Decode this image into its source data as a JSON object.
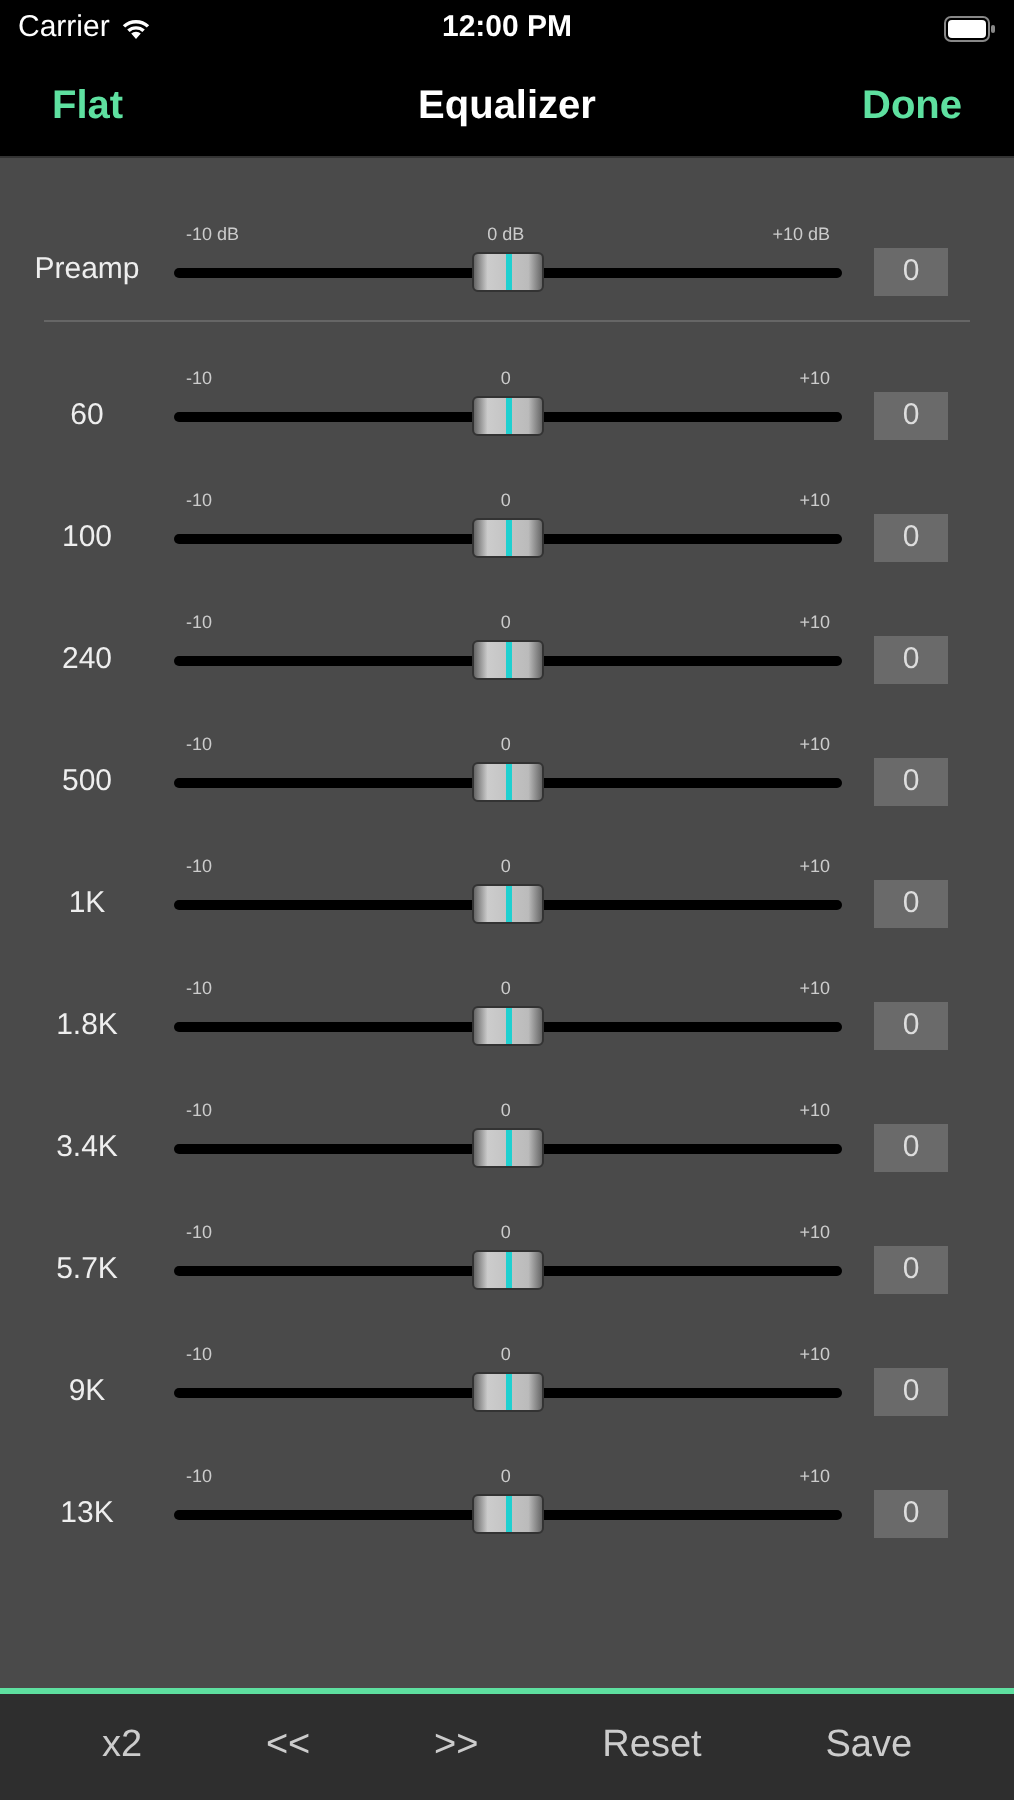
{
  "status_bar": {
    "carrier": "Carrier",
    "time": "12:00 PM"
  },
  "nav": {
    "left": "Flat",
    "title": "Equalizer",
    "right": "Done"
  },
  "preamp": {
    "label": "Preamp",
    "scale": [
      "-10 dB",
      "0 dB",
      "+10 dB"
    ],
    "level": 0.5,
    "value": "0"
  },
  "bands": [
    {
      "label": "60",
      "scale": [
        "-10",
        "0",
        "+10"
      ],
      "level": 0.5,
      "value": "0"
    },
    {
      "label": "100",
      "scale": [
        "-10",
        "0",
        "+10"
      ],
      "level": 0.5,
      "value": "0"
    },
    {
      "label": "240",
      "scale": [
        "-10",
        "0",
        "+10"
      ],
      "level": 0.5,
      "value": "0"
    },
    {
      "label": "500",
      "scale": [
        "-10",
        "0",
        "+10"
      ],
      "level": 0.5,
      "value": "0"
    },
    {
      "label": "1K",
      "scale": [
        "-10",
        "0",
        "+10"
      ],
      "level": 0.5,
      "value": "0"
    },
    {
      "label": "1.8K",
      "scale": [
        "-10",
        "0",
        "+10"
      ],
      "level": 0.5,
      "value": "0"
    },
    {
      "label": "3.4K",
      "scale": [
        "-10",
        "0",
        "+10"
      ],
      "level": 0.5,
      "value": "0"
    },
    {
      "label": "5.7K",
      "scale": [
        "-10",
        "0",
        "+10"
      ],
      "level": 0.5,
      "value": "0"
    },
    {
      "label": "9K",
      "scale": [
        "-10",
        "0",
        "+10"
      ],
      "level": 0.5,
      "value": "0"
    },
    {
      "label": "13K",
      "scale": [
        "-10",
        "0",
        "+10"
      ],
      "level": 0.5,
      "value": "0"
    }
  ],
  "toolbar": [
    "x2",
    "<<",
    ">>",
    "Reset",
    "Save"
  ]
}
